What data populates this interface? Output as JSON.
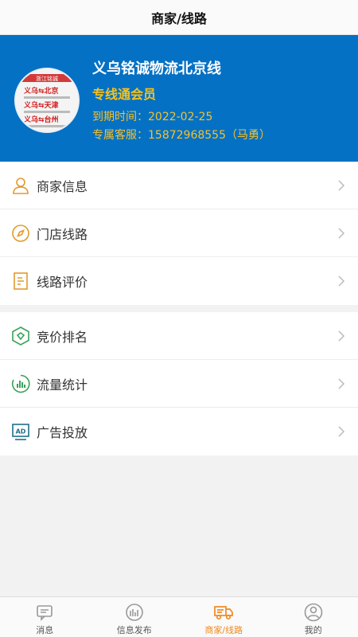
{
  "header": {
    "title": "商家/线路"
  },
  "profile": {
    "shop_name": "义乌铭诚物流北京线",
    "member_level": "专线通会员",
    "expire_text": "到期时间：2022-02-25",
    "service_text": "专属客服：15872968555（马勇）",
    "avatar_lines": [
      "浙江铭诚",
      "义乌⇆北京",
      "义乌⇆天津",
      "义乌⇆台州"
    ]
  },
  "menu_group1": [
    {
      "label": "商家信息",
      "icon": "user-icon"
    },
    {
      "label": "门店线路",
      "icon": "compass-icon"
    },
    {
      "label": "线路评价",
      "icon": "document-icon"
    }
  ],
  "menu_group2": [
    {
      "label": "竞价排名",
      "icon": "bid-icon"
    },
    {
      "label": "流量统计",
      "icon": "stats-icon"
    },
    {
      "label": "广告投放",
      "icon": "ad-icon"
    }
  ],
  "tabbar": {
    "items": [
      {
        "label": "消息",
        "icon": "message-icon",
        "active": false
      },
      {
        "label": "信息发布",
        "icon": "publish-icon",
        "active": false
      },
      {
        "label": "商家/线路",
        "icon": "truck-icon",
        "active": true
      },
      {
        "label": "我的",
        "icon": "profile-icon",
        "active": false
      }
    ]
  },
  "colors": {
    "banner": "#0571c4",
    "gold": "#f5c12a",
    "active_tab": "#f08a22"
  }
}
